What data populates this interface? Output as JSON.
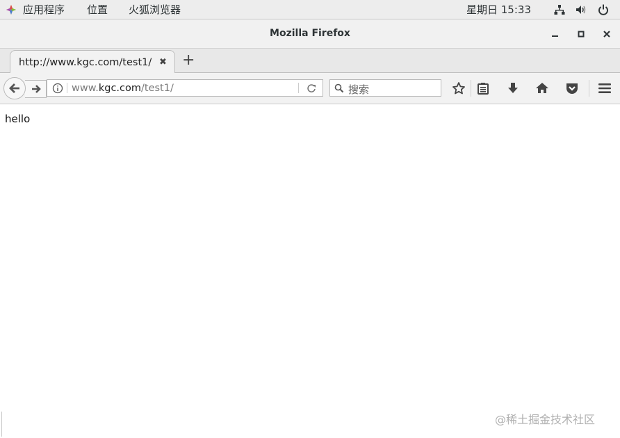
{
  "system_bar": {
    "menus": [
      "应用程序",
      "位置",
      "火狐浏览器"
    ],
    "clock": "星期日 15:33",
    "tray_icons": [
      "network-icon",
      "volume-icon",
      "power-icon"
    ]
  },
  "window": {
    "title": "Mozilla Firefox",
    "controls": [
      "minimize",
      "maximize",
      "close"
    ]
  },
  "tabs": [
    {
      "label": "http://www.kgc.com/test1/",
      "active": true
    }
  ],
  "new_tab_label": "+",
  "tab_close_glyph": "✖",
  "navbar": {
    "url_prefix": "www.",
    "url_domain": "kgc.com",
    "url_path": "/test1/",
    "search_placeholder": "搜索"
  },
  "content": {
    "text": "hello"
  },
  "watermark": "@稀土掘金技术社区"
}
